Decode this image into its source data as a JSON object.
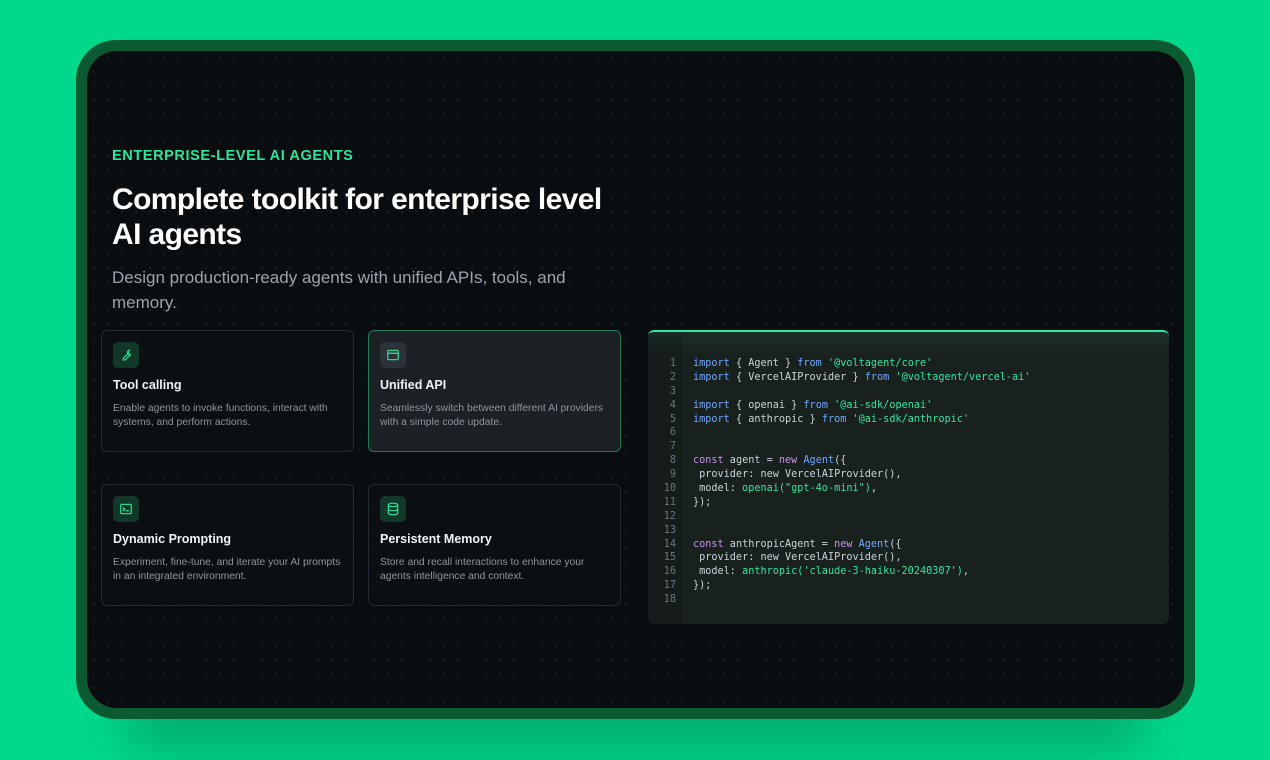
{
  "hero": {
    "eyebrow": "ENTERPRISE-LEVEL AI AGENTS",
    "title": "Complete toolkit for enterprise level AI agents",
    "subtitle": "Design production-ready agents with unified APIs, tools, and memory."
  },
  "features": [
    {
      "title": "Tool calling",
      "description": "Enable agents to invoke functions, interact with systems, and perform actions.",
      "icon": "wrench-icon",
      "active": false
    },
    {
      "title": "Unified API",
      "description": "Seamlessly switch between different AI providers with a simple code update.",
      "icon": "browser-window-icon",
      "active": true
    },
    {
      "title": "Dynamic Prompting",
      "description": "Experiment, fine-tune, and iterate your AI prompts in an integrated environment.",
      "icon": "terminal-icon",
      "active": false
    },
    {
      "title": "Persistent Memory",
      "description": "Store and recall interactions to enhance your agents intelligence and context.",
      "icon": "database-icon",
      "active": false
    }
  ],
  "code": {
    "line_numbers": [
      "1",
      "2",
      "3",
      "4",
      "5",
      "6",
      "7",
      "8",
      "9",
      "10",
      "11",
      "12",
      "13",
      "14",
      "15",
      "16",
      "17",
      "18"
    ],
    "lines": [
      [
        {
          "t": "import",
          "c": "im"
        },
        {
          "t": " { Agent } "
        },
        {
          "t": "from",
          "c": "im"
        },
        {
          "t": " "
        },
        {
          "t": "'@voltagent/core'",
          "c": "str"
        }
      ],
      [
        {
          "t": "import",
          "c": "im"
        },
        {
          "t": " { VercelAIProvider } "
        },
        {
          "t": "from",
          "c": "im"
        },
        {
          "t": " "
        },
        {
          "t": "'@voltagent/vercel-ai'",
          "c": "str"
        }
      ],
      [],
      [
        {
          "t": "import",
          "c": "im"
        },
        {
          "t": " { openai } "
        },
        {
          "t": "from",
          "c": "im"
        },
        {
          "t": " "
        },
        {
          "t": "'@ai-sdk/openai'",
          "c": "str"
        }
      ],
      [
        {
          "t": "import",
          "c": "im"
        },
        {
          "t": " { anthropic } "
        },
        {
          "t": "from",
          "c": "im"
        },
        {
          "t": " "
        },
        {
          "t": "'@ai-sdk/anthropic'",
          "c": "str"
        }
      ],
      [],
      [],
      [
        {
          "t": "const",
          "c": "kw"
        },
        {
          "t": " agent = "
        },
        {
          "t": "new",
          "c": "kw"
        },
        {
          "t": " "
        },
        {
          "t": "Agent",
          "c": "cls"
        },
        {
          "t": "({"
        }
      ],
      [
        {
          "t": " provider: new VercelAIProvider(),"
        }
      ],
      [
        {
          "t": " model: "
        },
        {
          "t": "openai(\"gpt-4o-mini\")",
          "c": "fn"
        },
        {
          "t": ","
        }
      ],
      [
        {
          "t": "});"
        }
      ],
      [],
      [],
      [
        {
          "t": "const",
          "c": "kw"
        },
        {
          "t": " anthropicAgent = "
        },
        {
          "t": "new",
          "c": "kw"
        },
        {
          "t": " "
        },
        {
          "t": "Agent",
          "c": "cls"
        },
        {
          "t": "({"
        }
      ],
      [
        {
          "t": " provider: new VercelAIProvider(),"
        }
      ],
      [
        {
          "t": " model: "
        },
        {
          "t": "anthropic('claude-3-haiku-20240307')",
          "c": "fn"
        },
        {
          "t": ","
        }
      ],
      [
        {
          "t": "});"
        }
      ],
      []
    ]
  },
  "colors": {
    "background": "#00d98c",
    "frame": "#0b5a31",
    "screen": "#0a0d10",
    "accent": "#2ee59d",
    "keyword": "#c792ea",
    "import": "#6ea8ff"
  }
}
